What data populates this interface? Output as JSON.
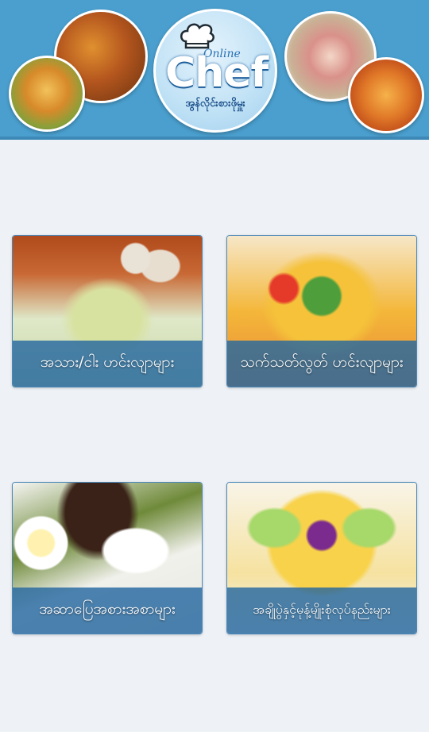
{
  "header": {
    "logo_online": "Online",
    "logo_chef": "Chef",
    "logo_tagline": "အွန်လိုင်းစားဖိုမှူး"
  },
  "categories": [
    {
      "label": "အသား/ငါး ဟင်းလျာများ",
      "icon": "meat-fish-dish-photo"
    },
    {
      "label": "သက်သတ်လွတ် ဟင်းလျာများ",
      "icon": "vegetarian-salad-photo"
    },
    {
      "label": "အဆာပြေအစားအစာများ",
      "icon": "snack-buns-photo"
    },
    {
      "label": "အချိုပွဲနှင့်မုန့်မျိုးစုံလုပ်နည်းများ",
      "icon": "dessert-orchid-photo"
    }
  ],
  "colors": {
    "header_bg": "#4a9fce",
    "label_bar": "#2668a0",
    "page_bg": "#eef2f6"
  }
}
